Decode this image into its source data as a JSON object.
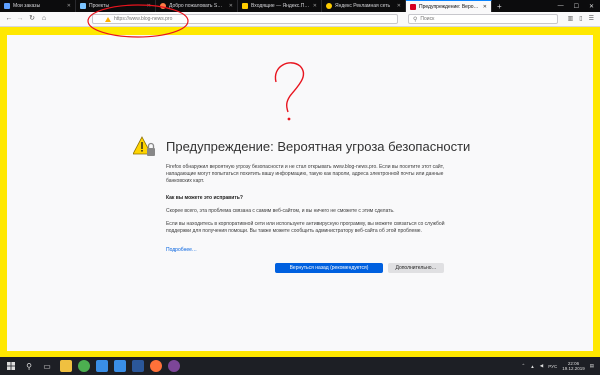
{
  "tabs": [
    {
      "label": "Мои заказы",
      "active": false,
      "favicon_color": "#5ea0ff"
    },
    {
      "label": "Проекты",
      "active": false,
      "favicon_color": "#7cc4ff"
    },
    {
      "label": "Добро пожаловать SOFTLO…",
      "active": false,
      "favicon_color": "#ff7a45"
    },
    {
      "label": "Входящие — Яндекс.Почта",
      "active": false,
      "favicon_color": "#ffcc00"
    },
    {
      "label": "Яндекс Рекламная сеть",
      "active": false,
      "favicon_color": "#ffcc00"
    },
    {
      "label": "Предупреждение: Вероятная",
      "active": true,
      "favicon_color": "#d70022"
    }
  ],
  "url": "https://www.blog-news.pro",
  "search": {
    "placeholder": "Поиск"
  },
  "warning": {
    "title": "Предупреждение: Вероятная угроза безопасности",
    "paragraph1": "Firefox обнаружил вероятную угрозу безопасности и не стал открывать www.blog-news.pro. Если вы посетите этот сайт, нападающие могут попытаться похитить вашу информацию, такую как пароли, адреса электронной почты или данные банковских карт.",
    "subheading": "Как вы можете это исправить?",
    "paragraph2": "Скорее всего, эта проблема связана с самим веб-сайтом, и вы ничего не сможете с этим сделать.",
    "paragraph3": "Если вы находитесь в корпоративной сети или используете антивирусную программу, вы можете связаться со службой поддержки для получения помощи. Вы также можете сообщить администратору веб-сайта об этой проблеме.",
    "learn_more": "Подробнее…",
    "back_button": "Вернуться назад (рекомендуется)",
    "advanced_button": "Дополнительно…"
  },
  "annotation": {
    "question_mark": "?",
    "color": "#e8141e",
    "frame_color": "#ffe800"
  },
  "taskbar": {
    "apps": [
      {
        "name": "explorer",
        "color": "#f0c040"
      },
      {
        "name": "chrome",
        "color": "#4caf50"
      },
      {
        "name": "store",
        "color": "#3a8ee6"
      },
      {
        "name": "mail",
        "color": "#3a8ee6"
      },
      {
        "name": "word",
        "color": "#2b579a"
      },
      {
        "name": "firefox",
        "color": "#ff7139"
      },
      {
        "name": "tor",
        "color": "#7d4698"
      }
    ],
    "language": "РУС",
    "time": "22:06",
    "date": "19.12.2019"
  }
}
